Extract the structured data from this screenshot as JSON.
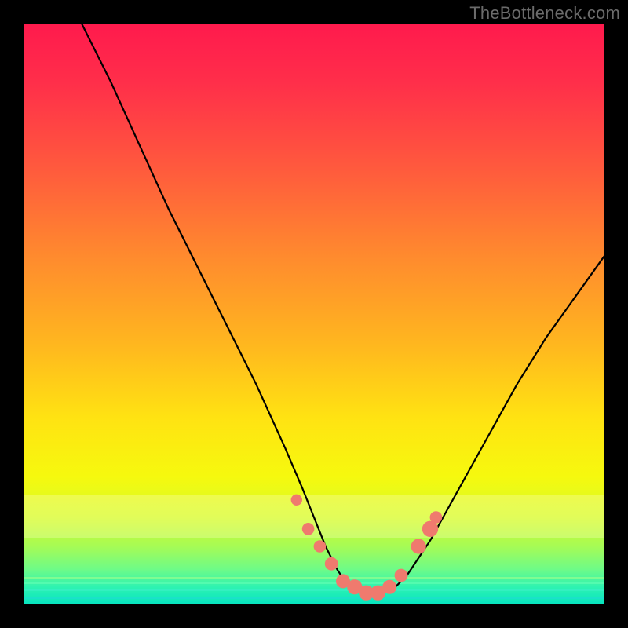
{
  "watermark": {
    "text": "TheBottleneck.com"
  },
  "colors": {
    "frame_bg": "#000000",
    "gradient_top": "#ff1a4d",
    "gradient_bottom": "#06e4c0",
    "curve_stroke": "#000000",
    "marker_fill": "#ef7a6e",
    "watermark_text": "#6b6b6b"
  },
  "chart_data": {
    "type": "line",
    "title": "",
    "xlabel": "",
    "ylabel": "",
    "xlim": [
      0,
      100
    ],
    "ylim": [
      0,
      100
    ],
    "grid": false,
    "legend": false,
    "description": "V-shaped bottleneck curve: high at left edge, drops to a flat minimum near x≈55–63, rises toward the right. Background vertical color gradient encodes badness (red=high, green=low).",
    "x": [
      10,
      15,
      20,
      25,
      30,
      35,
      40,
      45,
      48,
      50,
      52,
      54,
      56,
      58,
      60,
      62,
      64,
      66,
      70,
      75,
      80,
      85,
      90,
      95,
      100
    ],
    "values": [
      100,
      90,
      79,
      68,
      58,
      48,
      38,
      27,
      20,
      15,
      10,
      6,
      3,
      2,
      2,
      2,
      3,
      5,
      11,
      20,
      29,
      38,
      46,
      53,
      60
    ],
    "markers": {
      "note": "Salmon dot clusters along the low region of the curve near the minimum",
      "points": [
        {
          "x": 47,
          "y": 18,
          "r": 1.2
        },
        {
          "x": 49,
          "y": 13,
          "r": 1.3
        },
        {
          "x": 51,
          "y": 10,
          "r": 1.3
        },
        {
          "x": 53,
          "y": 7,
          "r": 1.4
        },
        {
          "x": 55,
          "y": 4,
          "r": 1.5
        },
        {
          "x": 57,
          "y": 3,
          "r": 1.6
        },
        {
          "x": 59,
          "y": 2,
          "r": 1.6
        },
        {
          "x": 61,
          "y": 2,
          "r": 1.6
        },
        {
          "x": 63,
          "y": 3,
          "r": 1.5
        },
        {
          "x": 65,
          "y": 5,
          "r": 1.4
        },
        {
          "x": 68,
          "y": 10,
          "r": 1.6
        },
        {
          "x": 70,
          "y": 13,
          "r": 1.7
        },
        {
          "x": 71,
          "y": 15,
          "r": 1.3
        }
      ]
    }
  }
}
